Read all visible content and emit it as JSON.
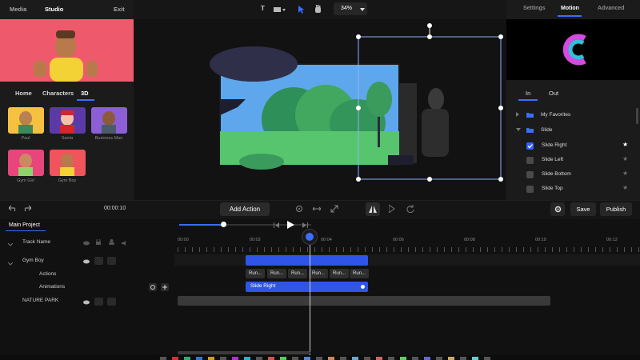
{
  "nav": {
    "tabs": [
      "Media",
      "Studio",
      "Exit"
    ]
  },
  "library": {
    "tabs": [
      "Home",
      "Characters",
      "3D"
    ],
    "characters": [
      {
        "name": "Paul",
        "color": "#f6c141"
      },
      {
        "name": "Santa",
        "color": "#5b3aa8"
      },
      {
        "name": "Business Man",
        "color": "#8d5fd6"
      },
      {
        "name": "Gym Girl",
        "color": "#e7457b"
      },
      {
        "name": "Gym Boy",
        "color": "#f0545c"
      }
    ]
  },
  "toolbar": {
    "zoom": "34%",
    "text_tool": "T"
  },
  "right": {
    "tabs": [
      "Settings",
      "Motion",
      "Advanced"
    ],
    "io_tabs": [
      "In",
      "Out"
    ],
    "folders": [
      "My Favorites",
      "Slide"
    ],
    "motions": [
      {
        "label": "Slide Right",
        "checked": true,
        "fav": true
      },
      {
        "label": "Slide Left",
        "checked": false,
        "fav": false
      },
      {
        "label": "Slide Bottom",
        "checked": false,
        "fav": false
      },
      {
        "label": "Slide Top",
        "checked": false,
        "fav": false
      }
    ]
  },
  "controls": {
    "time": "00:00:10",
    "add_action": "Add Action",
    "save": "Save",
    "publish": "Publish"
  },
  "timeline": {
    "project": "Main Project",
    "rows": [
      "Track Name",
      "Gym Boy",
      "Actions",
      "Animations",
      "NATURE PARK"
    ],
    "ruler": [
      "00:00",
      "00:02",
      "00:04",
      "00:06",
      "00:08",
      "00:10",
      "00:12"
    ],
    "chips": [
      "Run...",
      "Run...",
      "Run...",
      "Run...",
      "Run...",
      "Run..."
    ],
    "animation_clip": "Slide Right"
  },
  "colors": {
    "accent": "#2f62ff",
    "brand_pink": "#ee5a6c"
  }
}
